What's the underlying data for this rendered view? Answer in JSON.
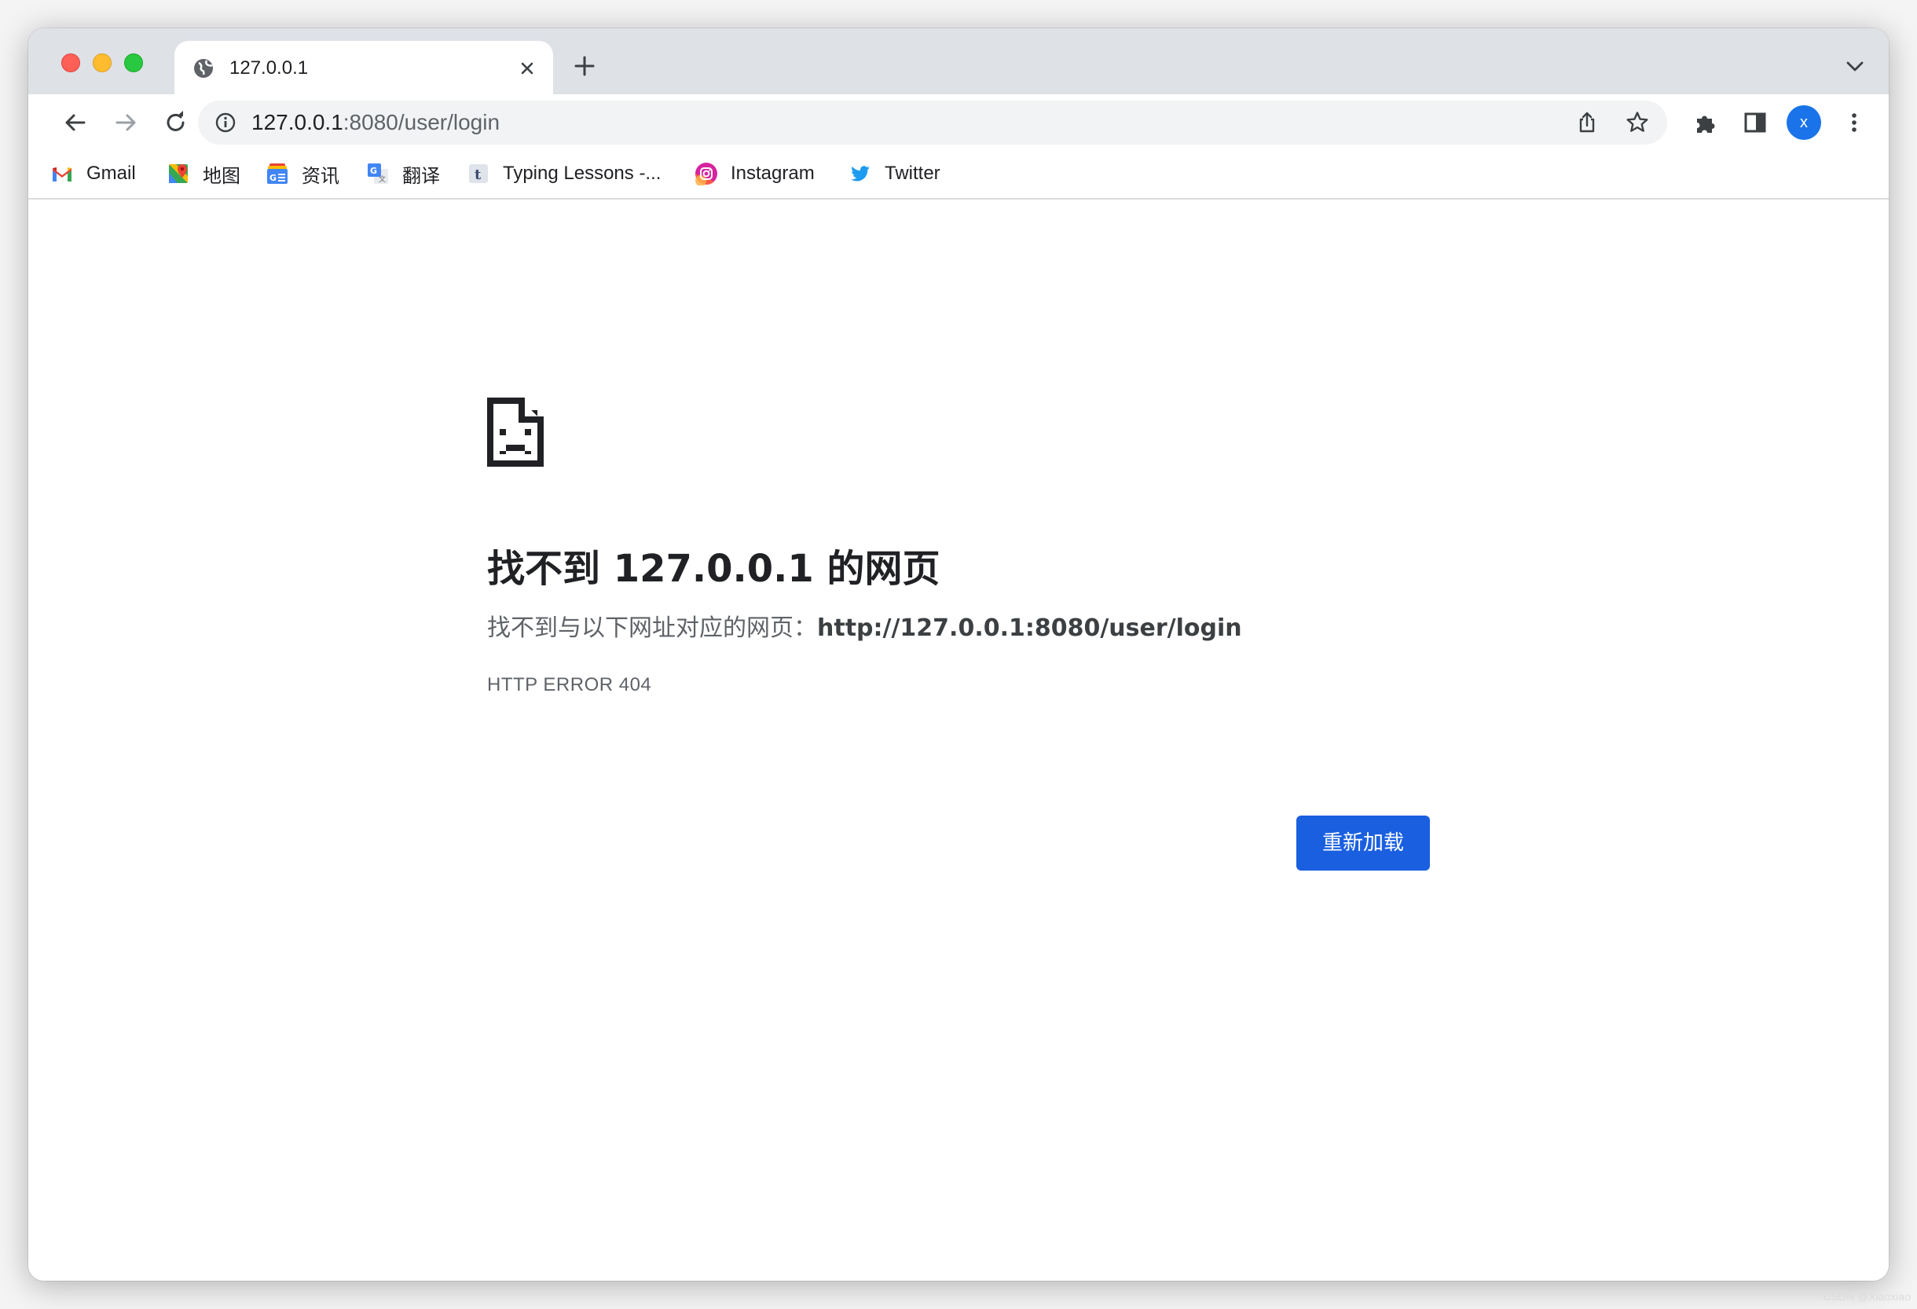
{
  "tab": {
    "title": "127.0.0.1"
  },
  "omnibox": {
    "host": "127.0.0.1",
    "path": ":8080/user/login"
  },
  "profile": {
    "initial": "x",
    "color": "#1a73e8"
  },
  "bookmarks": [
    {
      "label": "Gmail",
      "icon": "gmail-icon"
    },
    {
      "label": "地图",
      "icon": "maps-icon"
    },
    {
      "label": "资讯",
      "icon": "news-icon"
    },
    {
      "label": "翻译",
      "icon": "translate-icon"
    },
    {
      "label": "Typing Lessons -...",
      "icon": "typing-icon"
    },
    {
      "label": "Instagram",
      "icon": "instagram-icon"
    },
    {
      "label": "Twitter",
      "icon": "twitter-icon"
    }
  ],
  "error": {
    "title": "找不到 127.0.0.1 的网页",
    "description_prefix": "找不到与以下网址对应的网页：",
    "description_url": "http://127.0.0.1:8080/user/login",
    "code": "HTTP ERROR 404",
    "reload_label": "重新加载"
  },
  "colors": {
    "accent": "#1a5fe0",
    "tabstrip": "#dee1e6"
  },
  "watermark": "CSDN @Xiaoxiao"
}
